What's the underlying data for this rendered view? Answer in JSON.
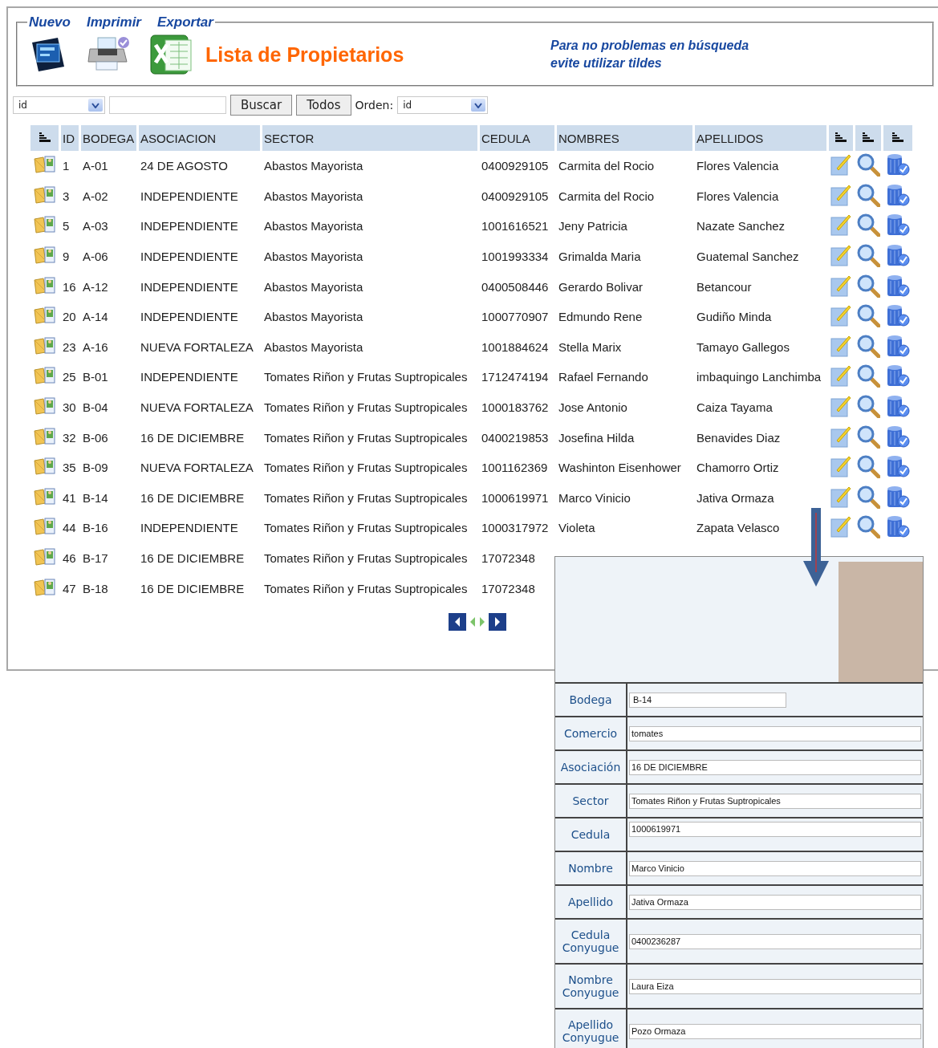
{
  "header": {
    "links": [
      "Nuevo",
      "Imprimir",
      "Exportar"
    ],
    "title": "Lista de Propietarios",
    "note_lines": [
      "Para no problemas en búsqueda",
      "evite utilizar tildes"
    ]
  },
  "toolbar": {
    "filter_field": {
      "value": "id"
    },
    "buttons": [
      "Buscar",
      "Todos"
    ],
    "order_label": "Orden:",
    "order_field": {
      "value": "id"
    }
  },
  "table": {
    "columns": [
      "ID",
      "BODEGA",
      "ASOCIACION",
      "SECTOR",
      "CEDULA",
      "NOMBRES",
      "APELLIDOS"
    ],
    "rows": [
      {
        "id": "1",
        "bodega": "A-01",
        "asociacion": "24 DE AGOSTO",
        "sector": "Abastos Mayorista",
        "cedula": "0400929105",
        "nombres": "Carmita del Rocio",
        "apellidos": "Flores Valencia"
      },
      {
        "id": "3",
        "bodega": "A-02",
        "asociacion": "INDEPENDIENTE",
        "sector": "Abastos Mayorista",
        "cedula": "0400929105",
        "nombres": "Carmita del Rocio",
        "apellidos": "Flores Valencia"
      },
      {
        "id": "5",
        "bodega": "A-03",
        "asociacion": "INDEPENDIENTE",
        "sector": "Abastos Mayorista",
        "cedula": "1001616521",
        "nombres": "Jeny Patricia",
        "apellidos": "Nazate Sanchez"
      },
      {
        "id": "9",
        "bodega": "A-06",
        "asociacion": "INDEPENDIENTE",
        "sector": "Abastos Mayorista",
        "cedula": "1001993334",
        "nombres": "Grimalda Maria",
        "apellidos": "Guatemal Sanchez"
      },
      {
        "id": "16",
        "bodega": "A-12",
        "asociacion": "INDEPENDIENTE",
        "sector": "Abastos Mayorista",
        "cedula": "0400508446",
        "nombres": "Gerardo Bolivar",
        "apellidos": "Betancour"
      },
      {
        "id": "20",
        "bodega": "A-14",
        "asociacion": "INDEPENDIENTE",
        "sector": "Abastos Mayorista",
        "cedula": "1000770907",
        "nombres": "Edmundo Rene",
        "apellidos": "Gudiño Minda"
      },
      {
        "id": "23",
        "bodega": "A-16",
        "asociacion": "NUEVA FORTALEZA",
        "sector": "Abastos Mayorista",
        "cedula": "1001884624",
        "nombres": "Stella Marix",
        "apellidos": "Tamayo Gallegos"
      },
      {
        "id": "25",
        "bodega": "B-01",
        "asociacion": "INDEPENDIENTE",
        "sector": "Tomates Riñon y Frutas Suptropicales",
        "cedula": "1712474194",
        "nombres": "Rafael Fernando",
        "apellidos": "imbaquingo Lanchimba"
      },
      {
        "id": "30",
        "bodega": "B-04",
        "asociacion": "NUEVA FORTALEZA",
        "sector": "Tomates Riñon y Frutas Suptropicales",
        "cedula": "1000183762",
        "nombres": "Jose Antonio",
        "apellidos": "Caiza Tayama"
      },
      {
        "id": "32",
        "bodega": "B-06",
        "asociacion": "16 DE DICIEMBRE",
        "sector": "Tomates Riñon y Frutas Suptropicales",
        "cedula": "0400219853",
        "nombres": "Josefina Hilda",
        "apellidos": "Benavides Diaz"
      },
      {
        "id": "35",
        "bodega": "B-09",
        "asociacion": "NUEVA FORTALEZA",
        "sector": "Tomates Riñon y Frutas Suptropicales",
        "cedula": "1001162369",
        "nombres": "Washinton Eisenhower",
        "apellidos": "Chamorro Ortiz"
      },
      {
        "id": "41",
        "bodega": "B-14",
        "asociacion": "16 DE DICIEMBRE",
        "sector": "Tomates Riñon y Frutas Suptropicales",
        "cedula": "1000619971",
        "nombres": "Marco Vinicio",
        "apellidos": "Jativa Ormaza"
      },
      {
        "id": "44",
        "bodega": "B-16",
        "asociacion": "INDEPENDIENTE",
        "sector": "Tomates Riñon y Frutas Suptropicales",
        "cedula": "1000317972",
        "nombres": "Violeta",
        "apellidos": "Zapata Velasco"
      },
      {
        "id": "46",
        "bodega": "B-17",
        "asociacion": "16 DE DICIEMBRE",
        "sector": "Tomates Riñon y Frutas Suptropicales",
        "cedula": "17072348"
      },
      {
        "id": "47",
        "bodega": "B-18",
        "asociacion": "16 DE DICIEMBRE",
        "sector": "Tomates Riñon y Frutas Suptropicales",
        "cedula": "17072348"
      }
    ]
  },
  "detail": {
    "fields": [
      {
        "label": "Bodega",
        "value": "B-14",
        "kind": "short"
      },
      {
        "label": "Comercio",
        "value": "tomates",
        "kind": "wide"
      },
      {
        "label": "Asociación",
        "value": "16 DE DICIEMBRE",
        "kind": "wide"
      },
      {
        "label": "Sector",
        "value": "Tomates Riñon y Frutas Suptropicales",
        "kind": "wide"
      },
      {
        "label": "Cedula",
        "value": "1000619971",
        "kind": "top"
      },
      {
        "label": "Nombre",
        "value": "Marco Vinicio",
        "kind": "wide"
      },
      {
        "label": "Apellido",
        "value": "Jativa Ormaza",
        "kind": "wide"
      },
      {
        "label": "Cedula Conyugue",
        "value": "0400236287",
        "kind": "wide"
      },
      {
        "label": "Nombre Conyugue",
        "value": "Laura Eiza",
        "kind": "wide"
      },
      {
        "label": "Apellido Conyugue",
        "value": "Pozo Ormaza",
        "kind": "wide"
      }
    ]
  }
}
